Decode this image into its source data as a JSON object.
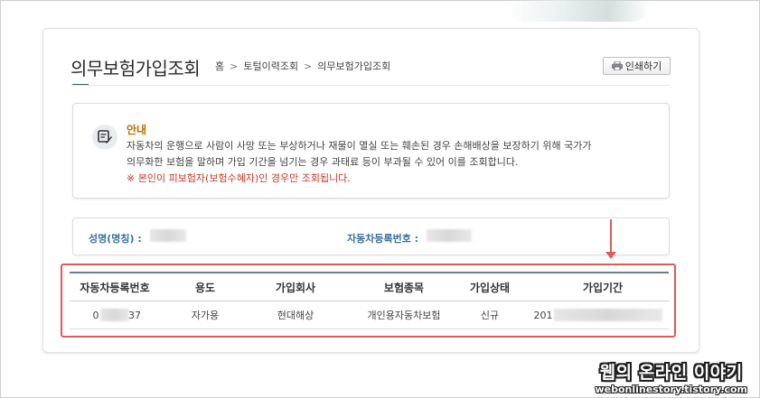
{
  "header": {
    "title": "의무보험가입조회",
    "print_label": "인쇄하기"
  },
  "breadcrumb": {
    "items": [
      "홈",
      "토털이력조회",
      "의무보험가입조회"
    ],
    "separator": ">"
  },
  "notice": {
    "title": "안내",
    "line1": "자동차의 운행으로 사람이 사망 또는 부상하거나 재물이 멸실 또는 훼손된 경우 손해배상을 보장하기 위해 국가가",
    "line2": "의무화한 보험을 말하며 가입 기간을 넘기는 경우 과태료 등이 부과될 수 있어 이를 조회합니다.",
    "warning": "※ 본인이 피보험자(보험수혜자)인 경우만 조회됩니다."
  },
  "owner": {
    "name_label": "성명(명칭) :",
    "reg_label": "자동차등록번호 :"
  },
  "table": {
    "headers": [
      "자동차등록번호",
      "용도",
      "가입회사",
      "보험종목",
      "가입상태",
      "가입기간"
    ],
    "row": {
      "reg_prefix": "0",
      "reg_suffix": "37",
      "usage": "자가용",
      "company": "현대해상",
      "type": "개인용자동차보험",
      "status": "신규",
      "period_prefix": "201"
    }
  },
  "watermark": {
    "title": "웹의 온라인 이야기",
    "url": "webonlinestory.tistory.com"
  },
  "colors": {
    "accent": "#3a6fa3",
    "notice_title": "#c46a00",
    "warning": "#c0392b",
    "highlight": "#e05a5a"
  }
}
